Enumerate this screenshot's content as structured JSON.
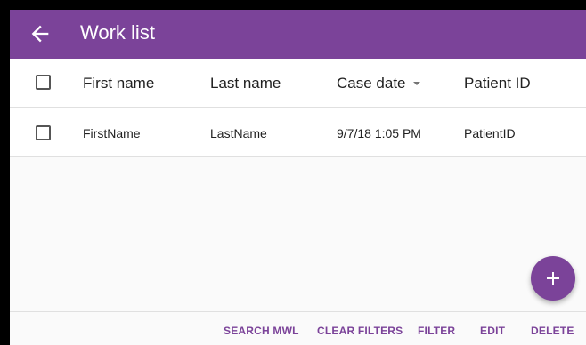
{
  "appbar": {
    "title": "Work list",
    "back_icon": "arrow-back-icon",
    "color": "#7b4399"
  },
  "table": {
    "columns": [
      {
        "label": "First name"
      },
      {
        "label": "Last name"
      },
      {
        "label": "Case date",
        "sort": "descending",
        "sort_icon": "sort-down-icon"
      },
      {
        "label": "Patient ID"
      }
    ],
    "rows": [
      {
        "first_name": "FirstName",
        "last_name": "LastName",
        "case_date": "9/7/18 1:05 PM",
        "patient_id": "PatientID",
        "checked": false
      }
    ]
  },
  "fab": {
    "icon": "plus-icon",
    "color": "#7b4399"
  },
  "actions": [
    {
      "label": "SEARCH MWL"
    },
    {
      "label": "CLEAR FILTERS"
    },
    {
      "label": "FILTER"
    },
    {
      "label": "EDIT"
    },
    {
      "label": "DELETE"
    }
  ]
}
